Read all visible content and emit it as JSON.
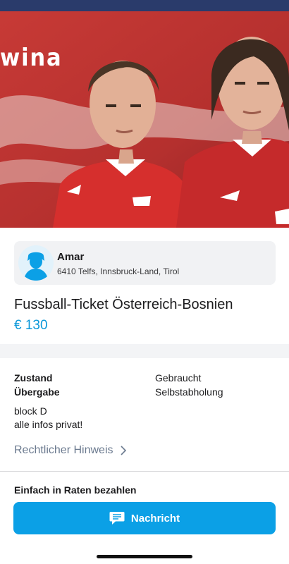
{
  "hero": {
    "banner_text": "wina"
  },
  "seller": {
    "name": "Amar",
    "location": "6410 Telfs, Innsbruck-Land, Tirol"
  },
  "listing": {
    "title": "Fussball-Ticket Österreich-Bosnien",
    "price": "€ 130"
  },
  "details": {
    "rows": [
      {
        "label": "Zustand",
        "value": "Gebraucht"
      },
      {
        "label": "Übergabe",
        "value": "Selbstabholung"
      }
    ],
    "description": [
      "block D",
      "alle infos privat!"
    ],
    "legal_link": "Rechtlicher Hinweis"
  },
  "installments": {
    "label": "Einfach in Raten bezahlen"
  },
  "action": {
    "message_label": "Nachricht"
  },
  "colors": {
    "accent": "#0ba0e6",
    "price": "#0b98d9",
    "link": "#6b7a8f"
  }
}
